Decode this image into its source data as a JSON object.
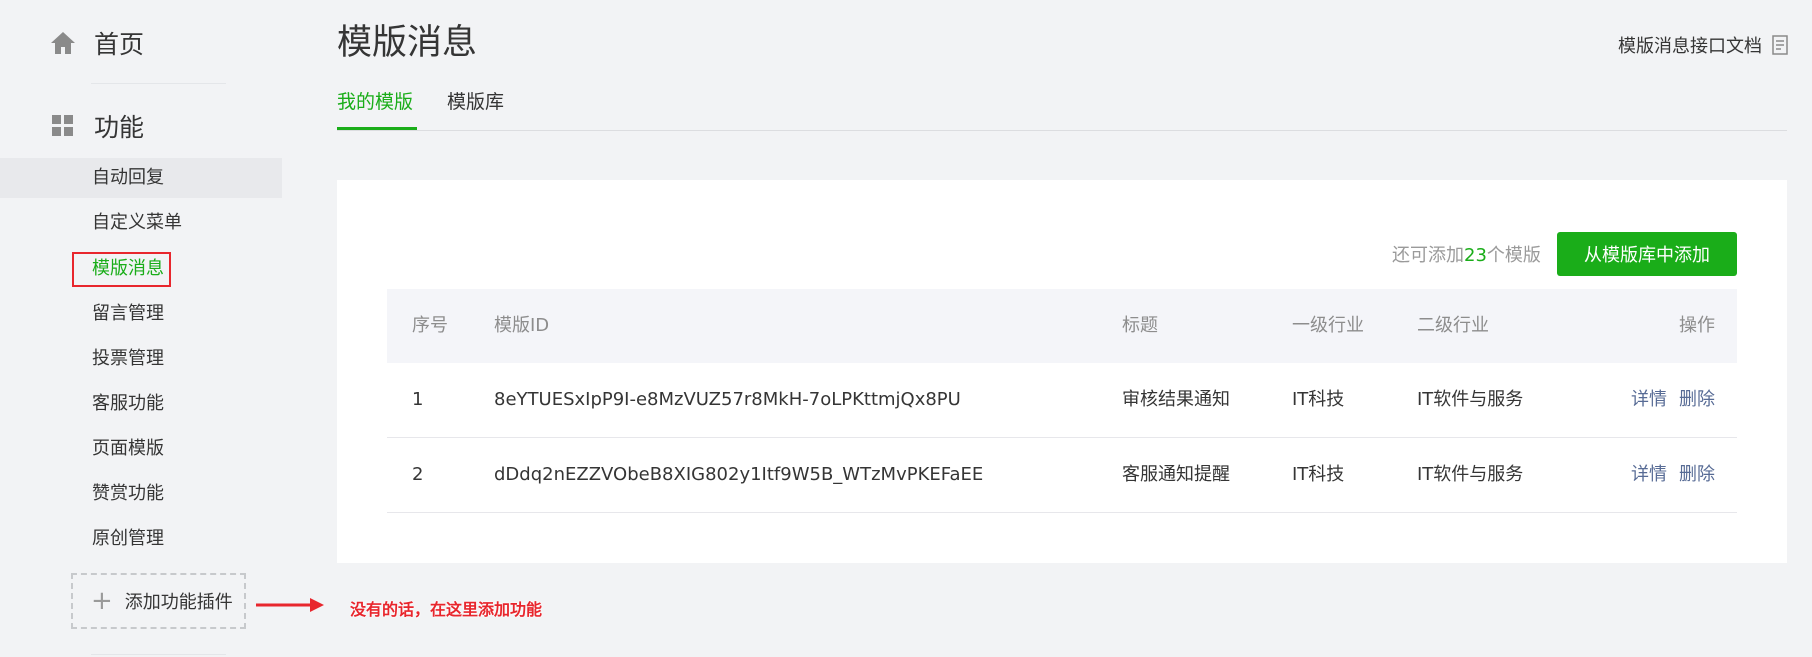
{
  "sidebar": {
    "home_label": "首页",
    "function_label": "功能",
    "items": [
      {
        "label": "自动回复"
      },
      {
        "label": "自定义菜单"
      },
      {
        "label": "模版消息"
      },
      {
        "label": "留言管理"
      },
      {
        "label": "投票管理"
      },
      {
        "label": "客服功能"
      },
      {
        "label": "页面模版"
      },
      {
        "label": "赞赏功能"
      },
      {
        "label": "原创管理"
      }
    ],
    "add_plugin_label": "添加功能插件"
  },
  "annotation": "没有的话，在这里添加功能",
  "colors": {
    "accent": "#1aad19",
    "link": "#576b95",
    "annotation": "#e8262d"
  },
  "page": {
    "title": "模版消息",
    "doc_link": "模版消息接口文档",
    "tabs": [
      {
        "label": "我的模版",
        "active": true
      },
      {
        "label": "模版库",
        "active": false
      }
    ]
  },
  "quota": {
    "prefix": "还可添加",
    "count": "23",
    "suffix": "个模版"
  },
  "add_button": "从模版库中添加",
  "table": {
    "headers": {
      "no": "序号",
      "id": "模版ID",
      "title": "标题",
      "industry1": "一级行业",
      "industry2": "二级行业",
      "ops": "操作"
    },
    "rows": [
      {
        "no": "1",
        "id": "8eYTUESxIpP9I-e8MzVUZ57r8MkH-7oLPKttmjQx8PU",
        "title": "审核结果通知",
        "industry1": "IT科技",
        "industry2": "IT软件与服务",
        "detail": "详情",
        "delete": "删除"
      },
      {
        "no": "2",
        "id": "dDdq2nEZZVObeB8XIG802y1Itf9W5B_WTzMvPKEFaEE",
        "title": "客服通知提醒",
        "industry1": "IT科技",
        "industry2": "IT软件与服务",
        "detail": "详情",
        "delete": "删除"
      }
    ]
  }
}
